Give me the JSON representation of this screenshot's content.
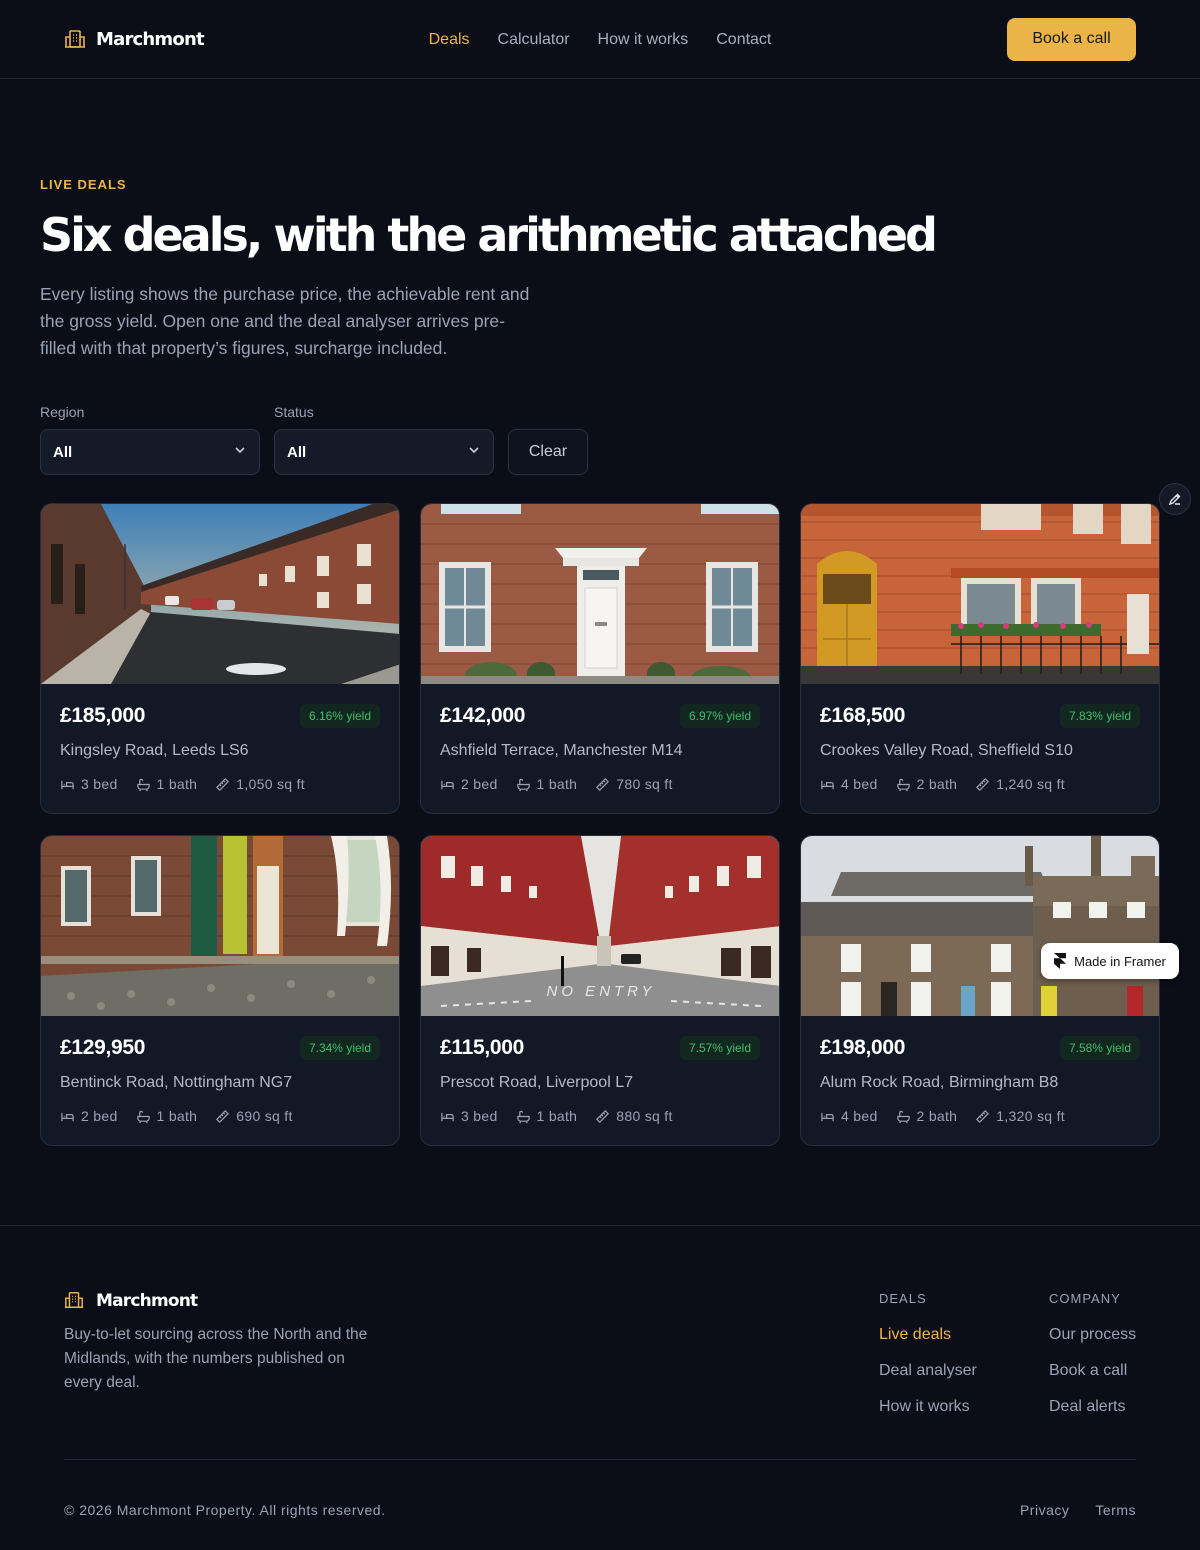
{
  "brand": {
    "name": "Marchmont"
  },
  "nav": {
    "links": [
      {
        "label": "Deals",
        "active": true
      },
      {
        "label": "Calculator",
        "active": false
      },
      {
        "label": "How it works",
        "active": false
      },
      {
        "label": "Contact",
        "active": false
      }
    ],
    "cta_label": "Book a call"
  },
  "hero": {
    "eyebrow": "LIVE DEALS",
    "headline": "Six deals, with the arithmetic attached",
    "lede": "Every listing shows the purchase price, the achievable rent and the gross yield. Open one and the deal analyser arrives pre-filled with that property’s figures, surcharge included."
  },
  "filters": {
    "region": {
      "label": "Region",
      "value": "All"
    },
    "status": {
      "label": "Status",
      "value": "All"
    },
    "clear_label": "Clear"
  },
  "deals": [
    {
      "price": "£185,000",
      "yield": "6.16% yield",
      "address": "Kingsley Road, Leeds LS6",
      "beds": "3 bed",
      "baths": "1 bath",
      "area": "1,050 sq ft"
    },
    {
      "price": "£142,000",
      "yield": "6.97% yield",
      "address": "Ashfield Terrace, Manchester M14",
      "beds": "2 bed",
      "baths": "1 bath",
      "area": "780 sq ft"
    },
    {
      "price": "£168,500",
      "yield": "7.83% yield",
      "address": "Crookes Valley Road, Sheffield S10",
      "beds": "4 bed",
      "baths": "2 bath",
      "area": "1,240 sq ft"
    },
    {
      "price": "£129,950",
      "yield": "7.34% yield",
      "address": "Bentinck Road, Nottingham NG7",
      "beds": "2 bed",
      "baths": "1 bath",
      "area": "690 sq ft"
    },
    {
      "price": "£115,000",
      "yield": "7.57% yield",
      "address": "Prescot Road, Liverpool L7",
      "beds": "3 bed",
      "baths": "1 bath",
      "area": "880 sq ft"
    },
    {
      "price": "£198,000",
      "yield": "7.58% yield",
      "address": "Alum Rock Road, Birmingham B8",
      "beds": "4 bed",
      "baths": "2 bath",
      "area": "1,320 sq ft"
    }
  ],
  "photo_text": {
    "no_entry": "NO ENTRY"
  },
  "framer_badge": "Made in Framer",
  "footer": {
    "brand_name": "Marchmont",
    "tagline": "Buy-to-let sourcing across the North and the Midlands, with the numbers published on every deal.",
    "columns": [
      {
        "heading": "DEALS",
        "links": [
          "Live deals",
          "Deal analyser",
          "How it works"
        ]
      },
      {
        "heading": "COMPANY",
        "links": [
          "Our process",
          "Book a call",
          "Deal alerts"
        ]
      }
    ],
    "copyright": "© 2026 Marchmont Property. All rights reserved.",
    "legal": [
      "Privacy",
      "Terms"
    ]
  },
  "colors": {
    "accent": "#ebb446",
    "yield_text": "#3fbf6c",
    "background": "#0b0e17",
    "card": "#131826"
  }
}
